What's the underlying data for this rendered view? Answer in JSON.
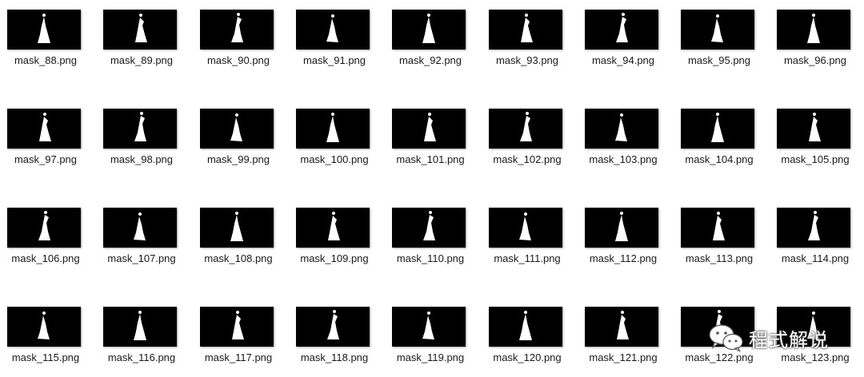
{
  "files": [
    "mask_88.png",
    "mask_89.png",
    "mask_90.png",
    "mask_91.png",
    "mask_92.png",
    "mask_93.png",
    "mask_94.png",
    "mask_95.png",
    "mask_96.png",
    "mask_97.png",
    "mask_98.png",
    "mask_99.png",
    "mask_100.png",
    "mask_101.png",
    "mask_102.png",
    "mask_103.png",
    "mask_104.png",
    "mask_105.png",
    "mask_106.png",
    "mask_107.png",
    "mask_108.png",
    "mask_109.png",
    "mask_110.png",
    "mask_111.png",
    "mask_112.png",
    "mask_113.png",
    "mask_114.png",
    "mask_115.png",
    "mask_116.png",
    "mask_117.png",
    "mask_118.png",
    "mask_119.png",
    "mask_120.png",
    "mask_121.png",
    "mask_122.png",
    "mask_123.png"
  ],
  "watermark": {
    "text": "程式解说",
    "icon": "wechat-icon"
  },
  "colors": {
    "thumbnail_background": "#000000",
    "mask_foreground": "#ffffff",
    "label_text": "#1a1a1a",
    "page_background": "#ffffff"
  }
}
